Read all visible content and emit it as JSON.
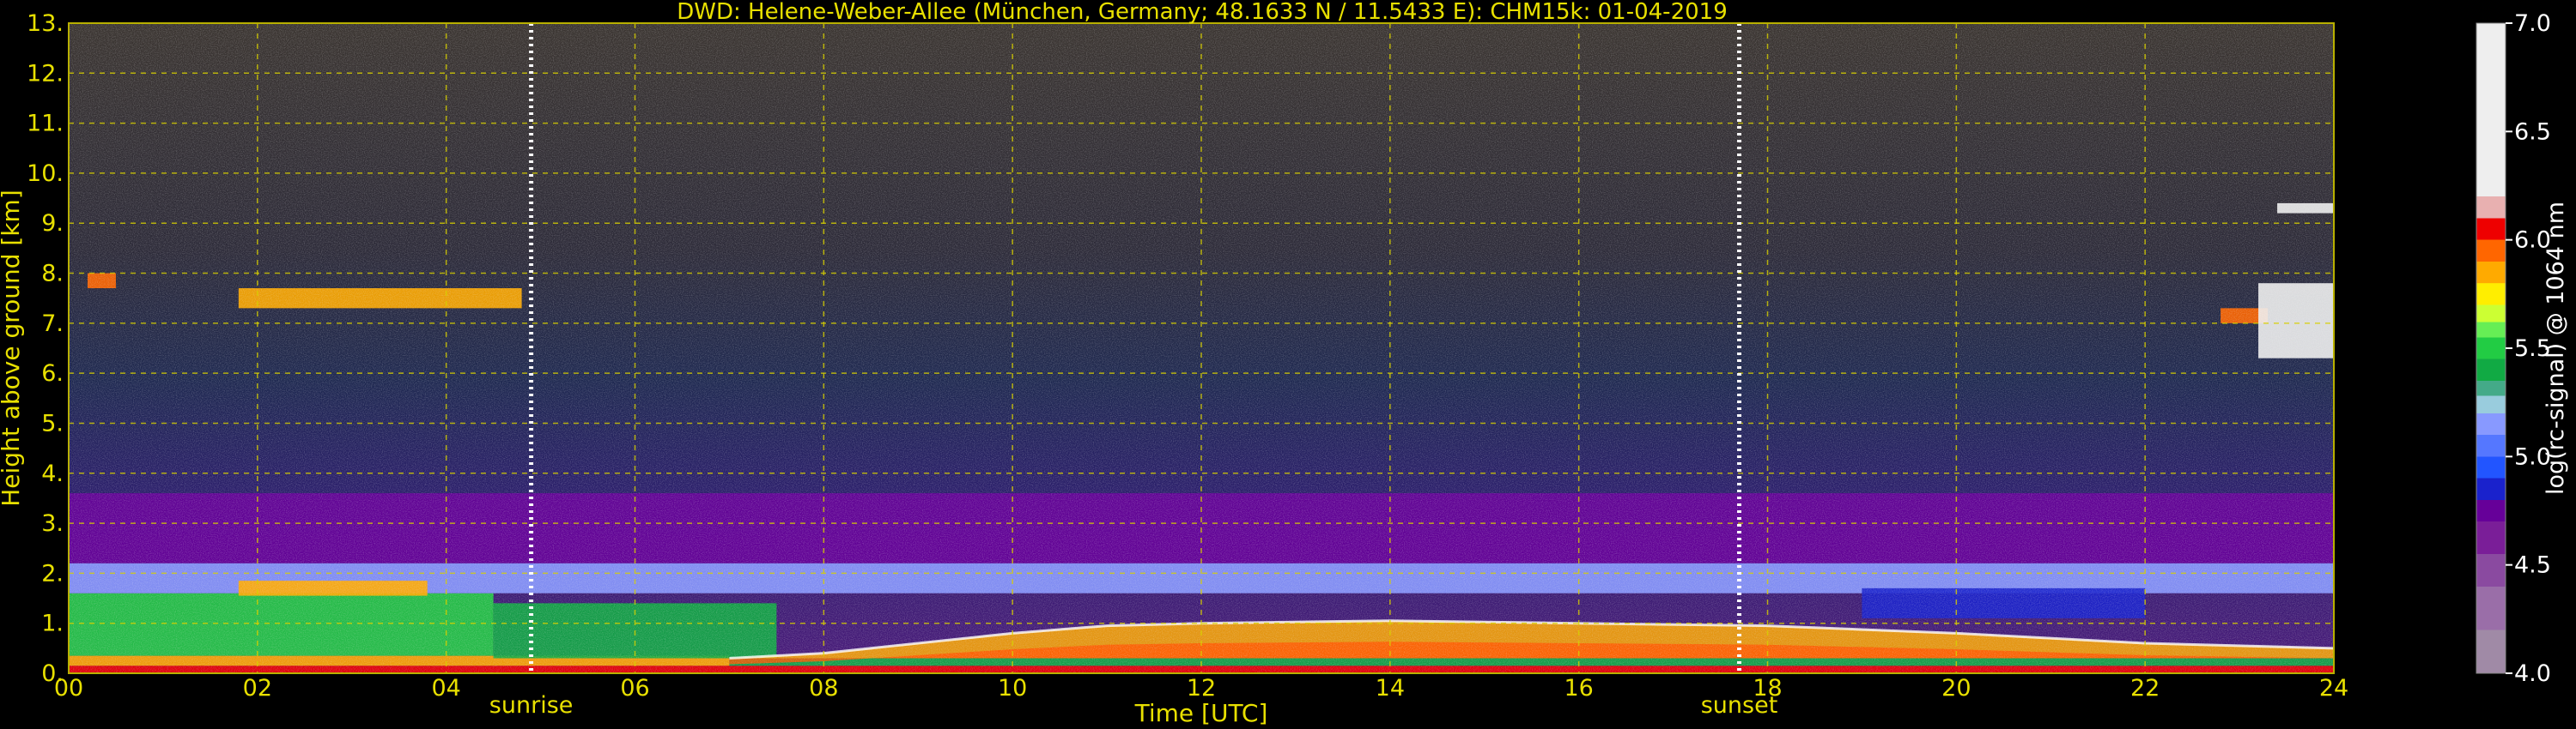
{
  "chart_data": {
    "type": "heatmap",
    "title": "DWD: Helene-Weber-Allee (München, Germany; 48.1633 N / 11.5433 E):    CHM15k: 01-04-2019",
    "xlabel": "Time [UTC]",
    "ylabel": "Height above ground [km]",
    "xlim": [
      0,
      24
    ],
    "ylim": [
      0,
      13
    ],
    "x_ticks": [
      {
        "value": 0,
        "label": "00"
      },
      {
        "value": 2,
        "label": "02"
      },
      {
        "value": 4,
        "label": "04"
      },
      {
        "value": 6,
        "label": "06"
      },
      {
        "value": 8,
        "label": "08"
      },
      {
        "value": 10,
        "label": "10"
      },
      {
        "value": 12,
        "label": "12"
      },
      {
        "value": 14,
        "label": "14"
      },
      {
        "value": 16,
        "label": "16"
      },
      {
        "value": 18,
        "label": "18"
      },
      {
        "value": 20,
        "label": "20"
      },
      {
        "value": 22,
        "label": "22"
      },
      {
        "value": 24,
        "label": "24"
      }
    ],
    "y_ticks": [
      {
        "value": 0,
        "label": "0."
      },
      {
        "value": 1,
        "label": "1."
      },
      {
        "value": 2,
        "label": "2."
      },
      {
        "value": 3,
        "label": "3."
      },
      {
        "value": 4,
        "label": "4."
      },
      {
        "value": 5,
        "label": "5."
      },
      {
        "value": 6,
        "label": "6."
      },
      {
        "value": 7,
        "label": "7."
      },
      {
        "value": 8,
        "label": "8."
      },
      {
        "value": 9,
        "label": "9."
      },
      {
        "value": 10,
        "label": "10."
      },
      {
        "value": 11,
        "label": "11."
      },
      {
        "value": 12,
        "label": "12."
      },
      {
        "value": 13,
        "label": "13."
      }
    ],
    "grid": true,
    "annotations": [
      {
        "text": "sunrise",
        "x": 4.9
      },
      {
        "text": "sunset",
        "x": 17.7
      }
    ],
    "colorbar": {
      "label": "log(rc-signal) @ 1064 nm",
      "range": [
        4.0,
        7.0
      ],
      "ticks": [
        {
          "value": 4.0,
          "label": "4.0"
        },
        {
          "value": 4.5,
          "label": "4.5"
        },
        {
          "value": 5.0,
          "label": "5.0"
        },
        {
          "value": 5.5,
          "label": "5.5"
        },
        {
          "value": 6.0,
          "label": "6.0"
        },
        {
          "value": 6.5,
          "label": "6.5"
        },
        {
          "value": 7.0,
          "label": "7.0"
        }
      ],
      "stops": [
        {
          "value": 4.0,
          "color": "#a08aa6"
        },
        {
          "value": 4.2,
          "color": "#9a6ea8"
        },
        {
          "value": 4.4,
          "color": "#8a4aa0"
        },
        {
          "value": 4.55,
          "color": "#7a1e98"
        },
        {
          "value": 4.7,
          "color": "#660099"
        },
        {
          "value": 4.8,
          "color": "#1a22cc"
        },
        {
          "value": 4.9,
          "color": "#2255ff"
        },
        {
          "value": 5.0,
          "color": "#5577ff"
        },
        {
          "value": 5.1,
          "color": "#8899ff"
        },
        {
          "value": 5.2,
          "color": "#99ccdd"
        },
        {
          "value": 5.28,
          "color": "#44aa88"
        },
        {
          "value": 5.35,
          "color": "#11aa44"
        },
        {
          "value": 5.45,
          "color": "#22cc44"
        },
        {
          "value": 5.55,
          "color": "#66ee55"
        },
        {
          "value": 5.62,
          "color": "#ccff33"
        },
        {
          "value": 5.7,
          "color": "#ffee00"
        },
        {
          "value": 5.8,
          "color": "#ffaa00"
        },
        {
          "value": 5.9,
          "color": "#ff6600"
        },
        {
          "value": 6.0,
          "color": "#ee0000"
        },
        {
          "value": 6.1,
          "color": "#e8b0b0"
        },
        {
          "value": 6.2,
          "color": "#eeeeee"
        },
        {
          "value": 7.0,
          "color": "#ffffff"
        }
      ]
    },
    "layers": [
      {
        "t": [
          0,
          24
        ],
        "h": [
          0.0,
          0.15
        ],
        "value": 6.0
      },
      {
        "t": [
          0,
          7
        ],
        "h": [
          0.15,
          0.35
        ],
        "value": 5.8
      },
      {
        "t": [
          7,
          24
        ],
        "h": [
          0.15,
          0.3
        ],
        "value": 5.4
      },
      {
        "t": [
          0,
          4.5
        ],
        "h": [
          0.35,
          1.6
        ],
        "value": 5.45
      },
      {
        "t": [
          4.5,
          7.5
        ],
        "h": [
          0.3,
          1.4
        ],
        "value": 5.4
      },
      {
        "t": [
          0,
          24
        ],
        "h": [
          1.6,
          2.2
        ],
        "value": 5.1
      },
      {
        "t": [
          0,
          24
        ],
        "h": [
          2.2,
          3.6
        ],
        "value": 4.7
      },
      {
        "t": [
          1.8,
          3.8
        ],
        "h": [
          1.55,
          1.85
        ],
        "value": 5.85
      },
      {
        "t": [
          1.8,
          4.8
        ],
        "h": [
          7.3,
          7.7
        ],
        "value": 5.85
      },
      {
        "t": [
          0.2,
          0.5
        ],
        "h": [
          7.7,
          8.0
        ],
        "value": 5.9
      },
      {
        "t": [
          22.8,
          23.3
        ],
        "h": [
          7.0,
          7.3
        ],
        "value": 5.95
      },
      {
        "t": [
          23.2,
          24
        ],
        "h": [
          6.3,
          7.8
        ],
        "value": 6.3
      },
      {
        "t": [
          23.4,
          24
        ],
        "h": [
          9.2,
          9.4
        ],
        "value": 6.3
      },
      {
        "t": [
          19,
          22
        ],
        "h": [
          1.1,
          1.7
        ],
        "value": 4.85
      }
    ],
    "mixing_layer_top": [
      {
        "t": 7.0,
        "h": 0.3
      },
      {
        "t": 8.0,
        "h": 0.4
      },
      {
        "t": 9.0,
        "h": 0.6
      },
      {
        "t": 10.0,
        "h": 0.8
      },
      {
        "t": 11.0,
        "h": 0.95
      },
      {
        "t": 12.0,
        "h": 1.0
      },
      {
        "t": 14.0,
        "h": 1.05
      },
      {
        "t": 16.0,
        "h": 1.0
      },
      {
        "t": 18.0,
        "h": 0.95
      },
      {
        "t": 20.0,
        "h": 0.8
      },
      {
        "t": 22.0,
        "h": 0.6
      },
      {
        "t": 24.0,
        "h": 0.5
      }
    ]
  }
}
